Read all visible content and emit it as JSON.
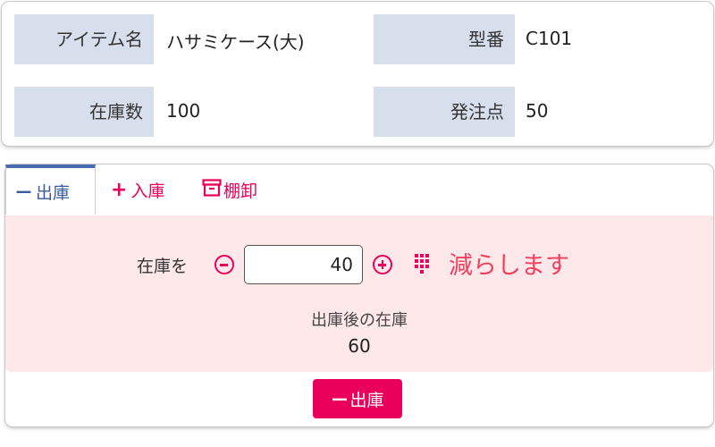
{
  "item": {
    "name_label": "アイテム名",
    "name_value": "ハサミケース(大)",
    "model_label": "型番",
    "model_value": "C101",
    "stock_label": "在庫数",
    "stock_value": "100",
    "reorder_label": "発注点",
    "reorder_value": "50"
  },
  "tabs": [
    {
      "icon": "minus-icon",
      "glyph": "ー",
      "label": "出庫",
      "active": true
    },
    {
      "icon": "plus-icon",
      "glyph": "+",
      "label": "入庫",
      "active": false
    },
    {
      "icon": "archive-icon",
      "glyph": "",
      "label": "棚卸",
      "active": false
    }
  ],
  "operation": {
    "prefix_label": "在庫を",
    "quantity": "40",
    "action_text": "減らします",
    "after_label": "出庫後の在庫",
    "after_value": "60",
    "submit_glyph": "ー",
    "submit_label": "出庫"
  },
  "colors": {
    "accent": "#e8005a",
    "active_tab": "#4a6db0",
    "label_bg": "#d8dfec",
    "panel_bg": "#ffe8ea",
    "action_text": "#f04060"
  }
}
